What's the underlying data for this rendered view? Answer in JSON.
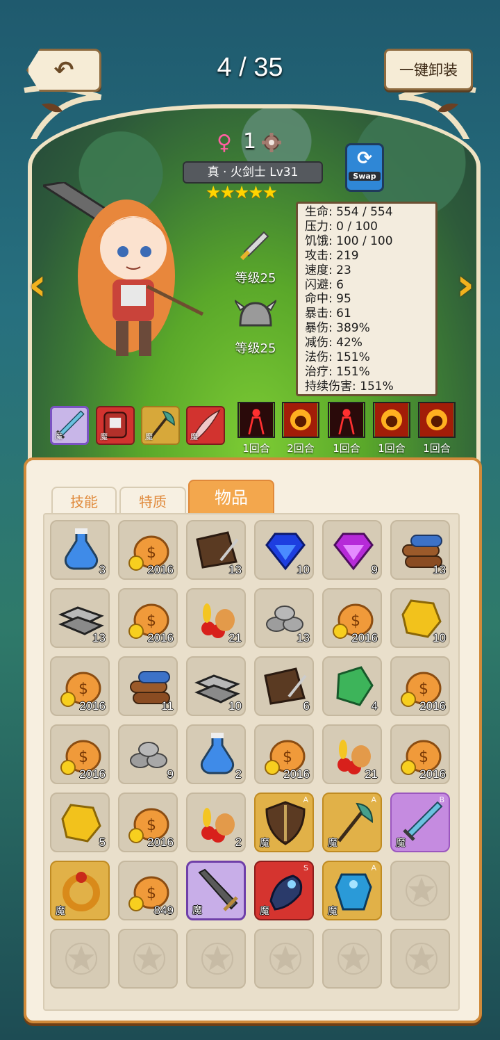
{
  "header": {
    "page_counter": "4 / 35",
    "unequip_label": "一键卸装",
    "back_icon": "undo-arrow-icon"
  },
  "hero": {
    "gender_symbol": "♀",
    "level_number": "1",
    "name": "真 · 火剑士 Lv31",
    "stars": "★★★★★",
    "swap_label": "Swap",
    "weapon_level": "等级25",
    "helmet_level": "等级25"
  },
  "stats": [
    "生命: 554 / 554",
    "压力: 0 / 100",
    "饥饿: 100 / 100",
    "攻击: 219",
    "速度: 23",
    "闪避: 6",
    "命中: 95",
    "暴击: 61",
    "暴伤: 389%",
    "减伤: 42%",
    "法伤: 151%",
    "治疗: 151%",
    "持续伤害: 151%"
  ],
  "equip_slots": [
    {
      "style": "purple",
      "mark": "魔",
      "icon": "sword"
    },
    {
      "style": "red",
      "mark": "魔",
      "icon": "armor"
    },
    {
      "style": "gold",
      "mark": "魔",
      "icon": "axe"
    },
    {
      "style": "red",
      "mark": "魔",
      "icon": "blade"
    }
  ],
  "buffs": [
    {
      "icon": "dark-figure",
      "label": "1回合"
    },
    {
      "icon": "fire-face",
      "label": "2回合"
    },
    {
      "icon": "dark-figure",
      "label": "1回合"
    },
    {
      "icon": "fire-face",
      "label": "1回合"
    },
    {
      "icon": "fire-face",
      "label": "1回合"
    }
  ],
  "tabs": [
    {
      "label": "技能"
    },
    {
      "label": "特质"
    },
    {
      "label": "物品",
      "active": true
    }
  ],
  "inventory": [
    {
      "icon": "potion",
      "count": "3"
    },
    {
      "icon": "money-bag",
      "count": "2016"
    },
    {
      "icon": "leather",
      "count": "13"
    },
    {
      "icon": "blue-gem",
      "count": "10"
    },
    {
      "icon": "purple-gem",
      "count": "9"
    },
    {
      "icon": "wood",
      "count": "13"
    },
    {
      "icon": "iron",
      "count": "13"
    },
    {
      "icon": "money-bag",
      "count": "2016"
    },
    {
      "icon": "food",
      "count": "21"
    },
    {
      "icon": "stone",
      "count": "13"
    },
    {
      "icon": "money-bag",
      "count": "2016"
    },
    {
      "icon": "gold-ore",
      "count": "10"
    },
    {
      "icon": "money-bag",
      "count": "2016"
    },
    {
      "icon": "wood",
      "count": "11"
    },
    {
      "icon": "iron",
      "count": "10"
    },
    {
      "icon": "leather",
      "count": "6"
    },
    {
      "icon": "green-gem",
      "count": "4"
    },
    {
      "icon": "money-bag",
      "count": "2016"
    },
    {
      "icon": "money-bag",
      "count": "2016"
    },
    {
      "icon": "stone",
      "count": "9"
    },
    {
      "icon": "potion",
      "count": "2"
    },
    {
      "icon": "money-bag",
      "count": "2016"
    },
    {
      "icon": "food",
      "count": "21"
    },
    {
      "icon": "money-bag",
      "count": "2016"
    },
    {
      "icon": "gold-ore",
      "count": "5"
    },
    {
      "icon": "money-bag",
      "count": "2016"
    },
    {
      "icon": "food",
      "count": "2"
    },
    {
      "icon": "shield",
      "rarity": "A",
      "grade": "A",
      "mark": "魔"
    },
    {
      "icon": "axe",
      "rarity": "A",
      "grade": "A",
      "mark": "魔"
    },
    {
      "icon": "sword",
      "rarity": "B",
      "grade": "B",
      "mark": "魔"
    },
    {
      "icon": "ring",
      "rarity": "A",
      "mark": "魔"
    },
    {
      "icon": "money-bag",
      "count": "849"
    },
    {
      "icon": "dark-sword",
      "rarity": "P",
      "mark": "魔"
    },
    {
      "icon": "gauntlet",
      "rarity": "S",
      "grade": "S",
      "mark": "魔"
    },
    {
      "icon": "blue-armor",
      "rarity": "A",
      "grade": "A",
      "mark": "魔"
    },
    {
      "icon": "empty"
    },
    {
      "icon": "empty"
    },
    {
      "icon": "empty"
    },
    {
      "icon": "empty"
    },
    {
      "icon": "empty"
    },
    {
      "icon": "empty"
    },
    {
      "icon": "empty"
    }
  ],
  "colors": {
    "accent": "#f3a74d",
    "panel_border": "#d08a3a"
  }
}
